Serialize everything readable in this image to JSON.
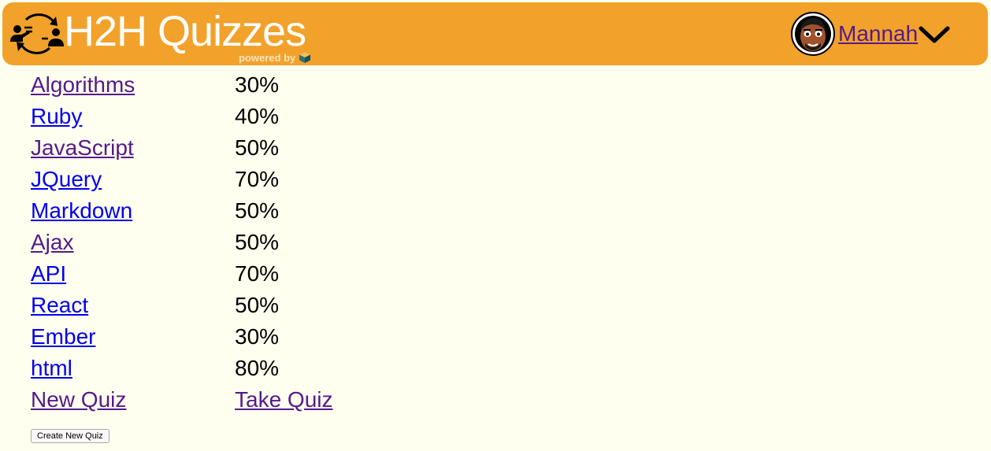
{
  "header": {
    "title": "H2H Quizzes",
    "powered_by": "powered by",
    "user_name": "Mannah",
    "background_color": "#f2a22a"
  },
  "quizzes": [
    {
      "name": "Algorithms",
      "score": "30%",
      "visited": true
    },
    {
      "name": "Ruby",
      "score": "40%",
      "visited": false
    },
    {
      "name": "JavaScript",
      "score": "50%",
      "visited": true
    },
    {
      "name": "JQuery",
      "score": "70%",
      "visited": false
    },
    {
      "name": "Markdown",
      "score": "50%",
      "visited": false
    },
    {
      "name": "Ajax",
      "score": "50%",
      "visited": true
    },
    {
      "name": "API",
      "score": "70%",
      "visited": false
    },
    {
      "name": "React",
      "score": "50%",
      "visited": false
    },
    {
      "name": "Ember",
      "score": "30%",
      "visited": false
    },
    {
      "name": "html",
      "score": "80%",
      "visited": false
    }
  ],
  "actions": {
    "new_quiz": "New Quiz",
    "take_quiz": "Take Quiz",
    "create_button": "Create New Quiz"
  },
  "colors": {
    "visited_link": "#551a8b",
    "unvisited_link": "#0000ee",
    "page_background": "#fffff0"
  }
}
